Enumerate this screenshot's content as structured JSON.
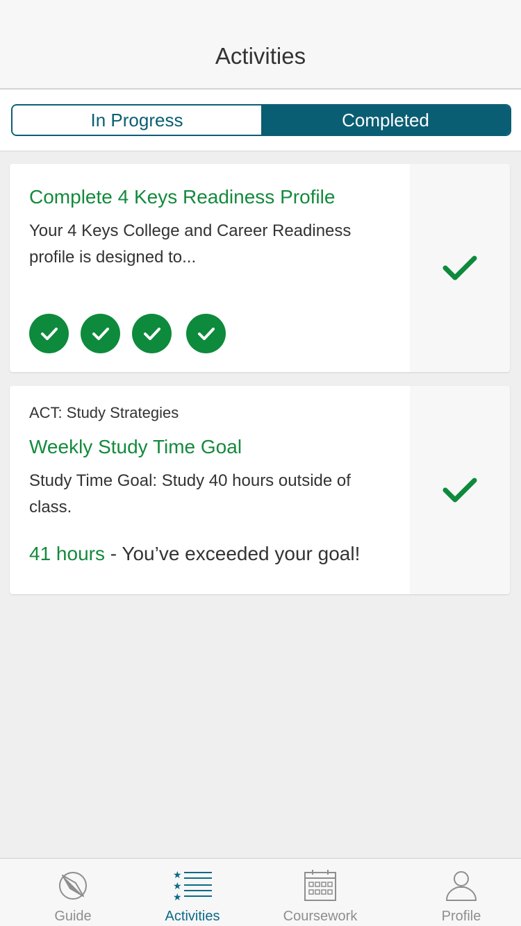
{
  "header": {
    "title": "Activities"
  },
  "segments": {
    "in_progress": "In Progress",
    "completed": "Completed",
    "selected": "Completed"
  },
  "cards": [
    {
      "title": "Complete 4 Keys Readiness Profile",
      "description": "Your 4 Keys College and Career Readiness profile is designed to...",
      "steps_completed": 4,
      "status_icon": "check-icon"
    },
    {
      "category": "ACT: Study Strategies",
      "title": "Weekly Study Time Goal",
      "description": "Study Time Goal: Study 40 hours outside of class.",
      "result_hours": "41 hours",
      "result_message": " - You’ve exceeded your goal!",
      "status_icon": "check-icon"
    }
  ],
  "tabs": [
    {
      "label": "Guide",
      "icon": "compass-icon"
    },
    {
      "label": "Activities",
      "icon": "starred-list-icon",
      "active": true
    },
    {
      "label": "Coursework",
      "icon": "calendar-icon"
    },
    {
      "label": "Profile",
      "icon": "person-icon"
    }
  ],
  "colors": {
    "accent": "#0a5e73",
    "success": "#138a3c",
    "tab_active": "#0a6a86"
  }
}
